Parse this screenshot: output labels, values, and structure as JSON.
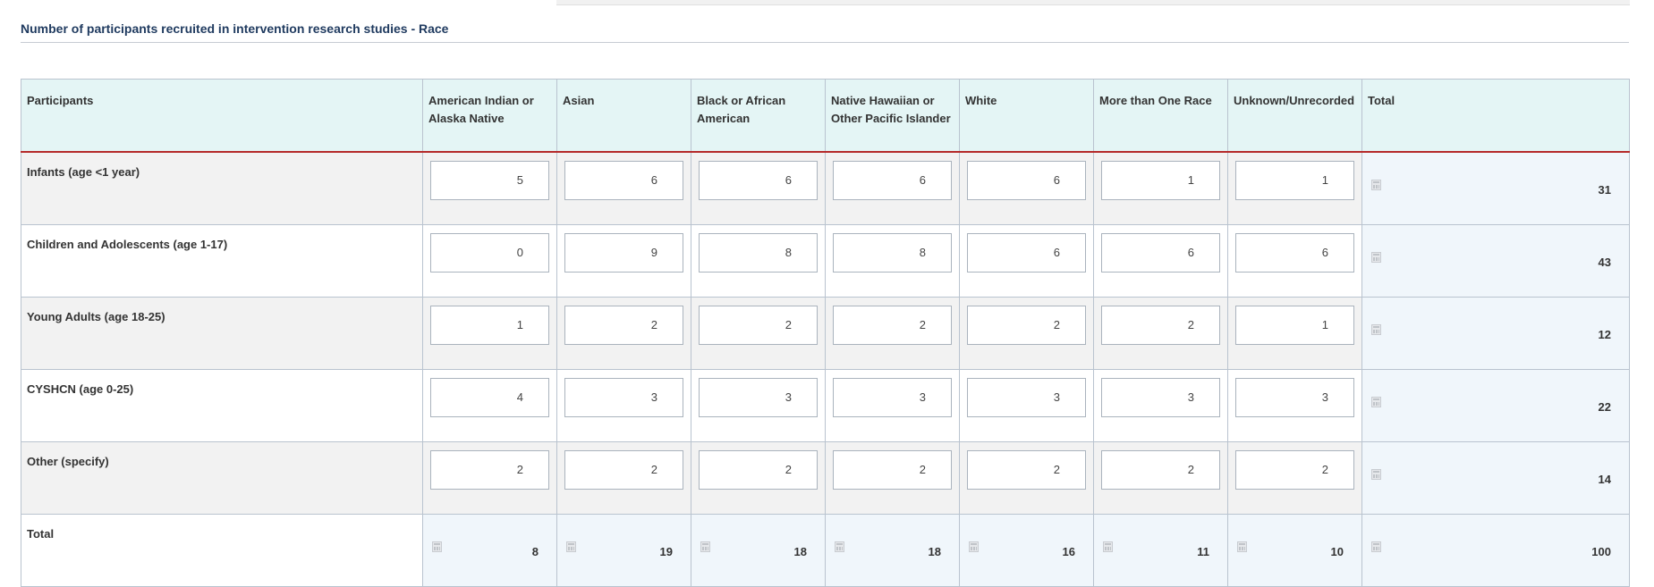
{
  "section": {
    "title": "Number of participants recruited in intervention research studies - Race"
  },
  "table": {
    "headers": [
      "Participants",
      "American Indian or Alaska Native",
      "Asian",
      "Black or African American",
      "Native Hawaiian or Other Pacific Islander",
      "White",
      "More than One Race",
      "Unknown/Unrecorded",
      "Total"
    ],
    "rows": [
      {
        "label": "Infants (age <1 year)",
        "values": [
          "5",
          "6",
          "6",
          "6",
          "6",
          "1",
          "1"
        ],
        "total": "31"
      },
      {
        "label": "Children and Adolescents (age 1-17)",
        "values": [
          "0",
          "9",
          "8",
          "8",
          "6",
          "6",
          "6"
        ],
        "total": "43"
      },
      {
        "label": "Young Adults (age 18-25)",
        "values": [
          "1",
          "2",
          "2",
          "2",
          "2",
          "2",
          "1"
        ],
        "total": "12"
      },
      {
        "label": "CYSHCN (age 0-25)",
        "values": [
          "4",
          "3",
          "3",
          "3",
          "3",
          "3",
          "3"
        ],
        "total": "22"
      },
      {
        "label": "Other (specify)",
        "values": [
          "2",
          "2",
          "2",
          "2",
          "2",
          "2",
          "2"
        ],
        "total": "14"
      }
    ],
    "total_row": {
      "label": "Total",
      "values": [
        "8",
        "19",
        "18",
        "18",
        "16",
        "11",
        "10"
      ],
      "total": "100"
    }
  },
  "icons": {
    "calculated_field": "calculator-icon"
  },
  "colors": {
    "header_bg": "#e4f5f5",
    "header_rule": "#b52a2a",
    "title": "#1f3a5f"
  }
}
